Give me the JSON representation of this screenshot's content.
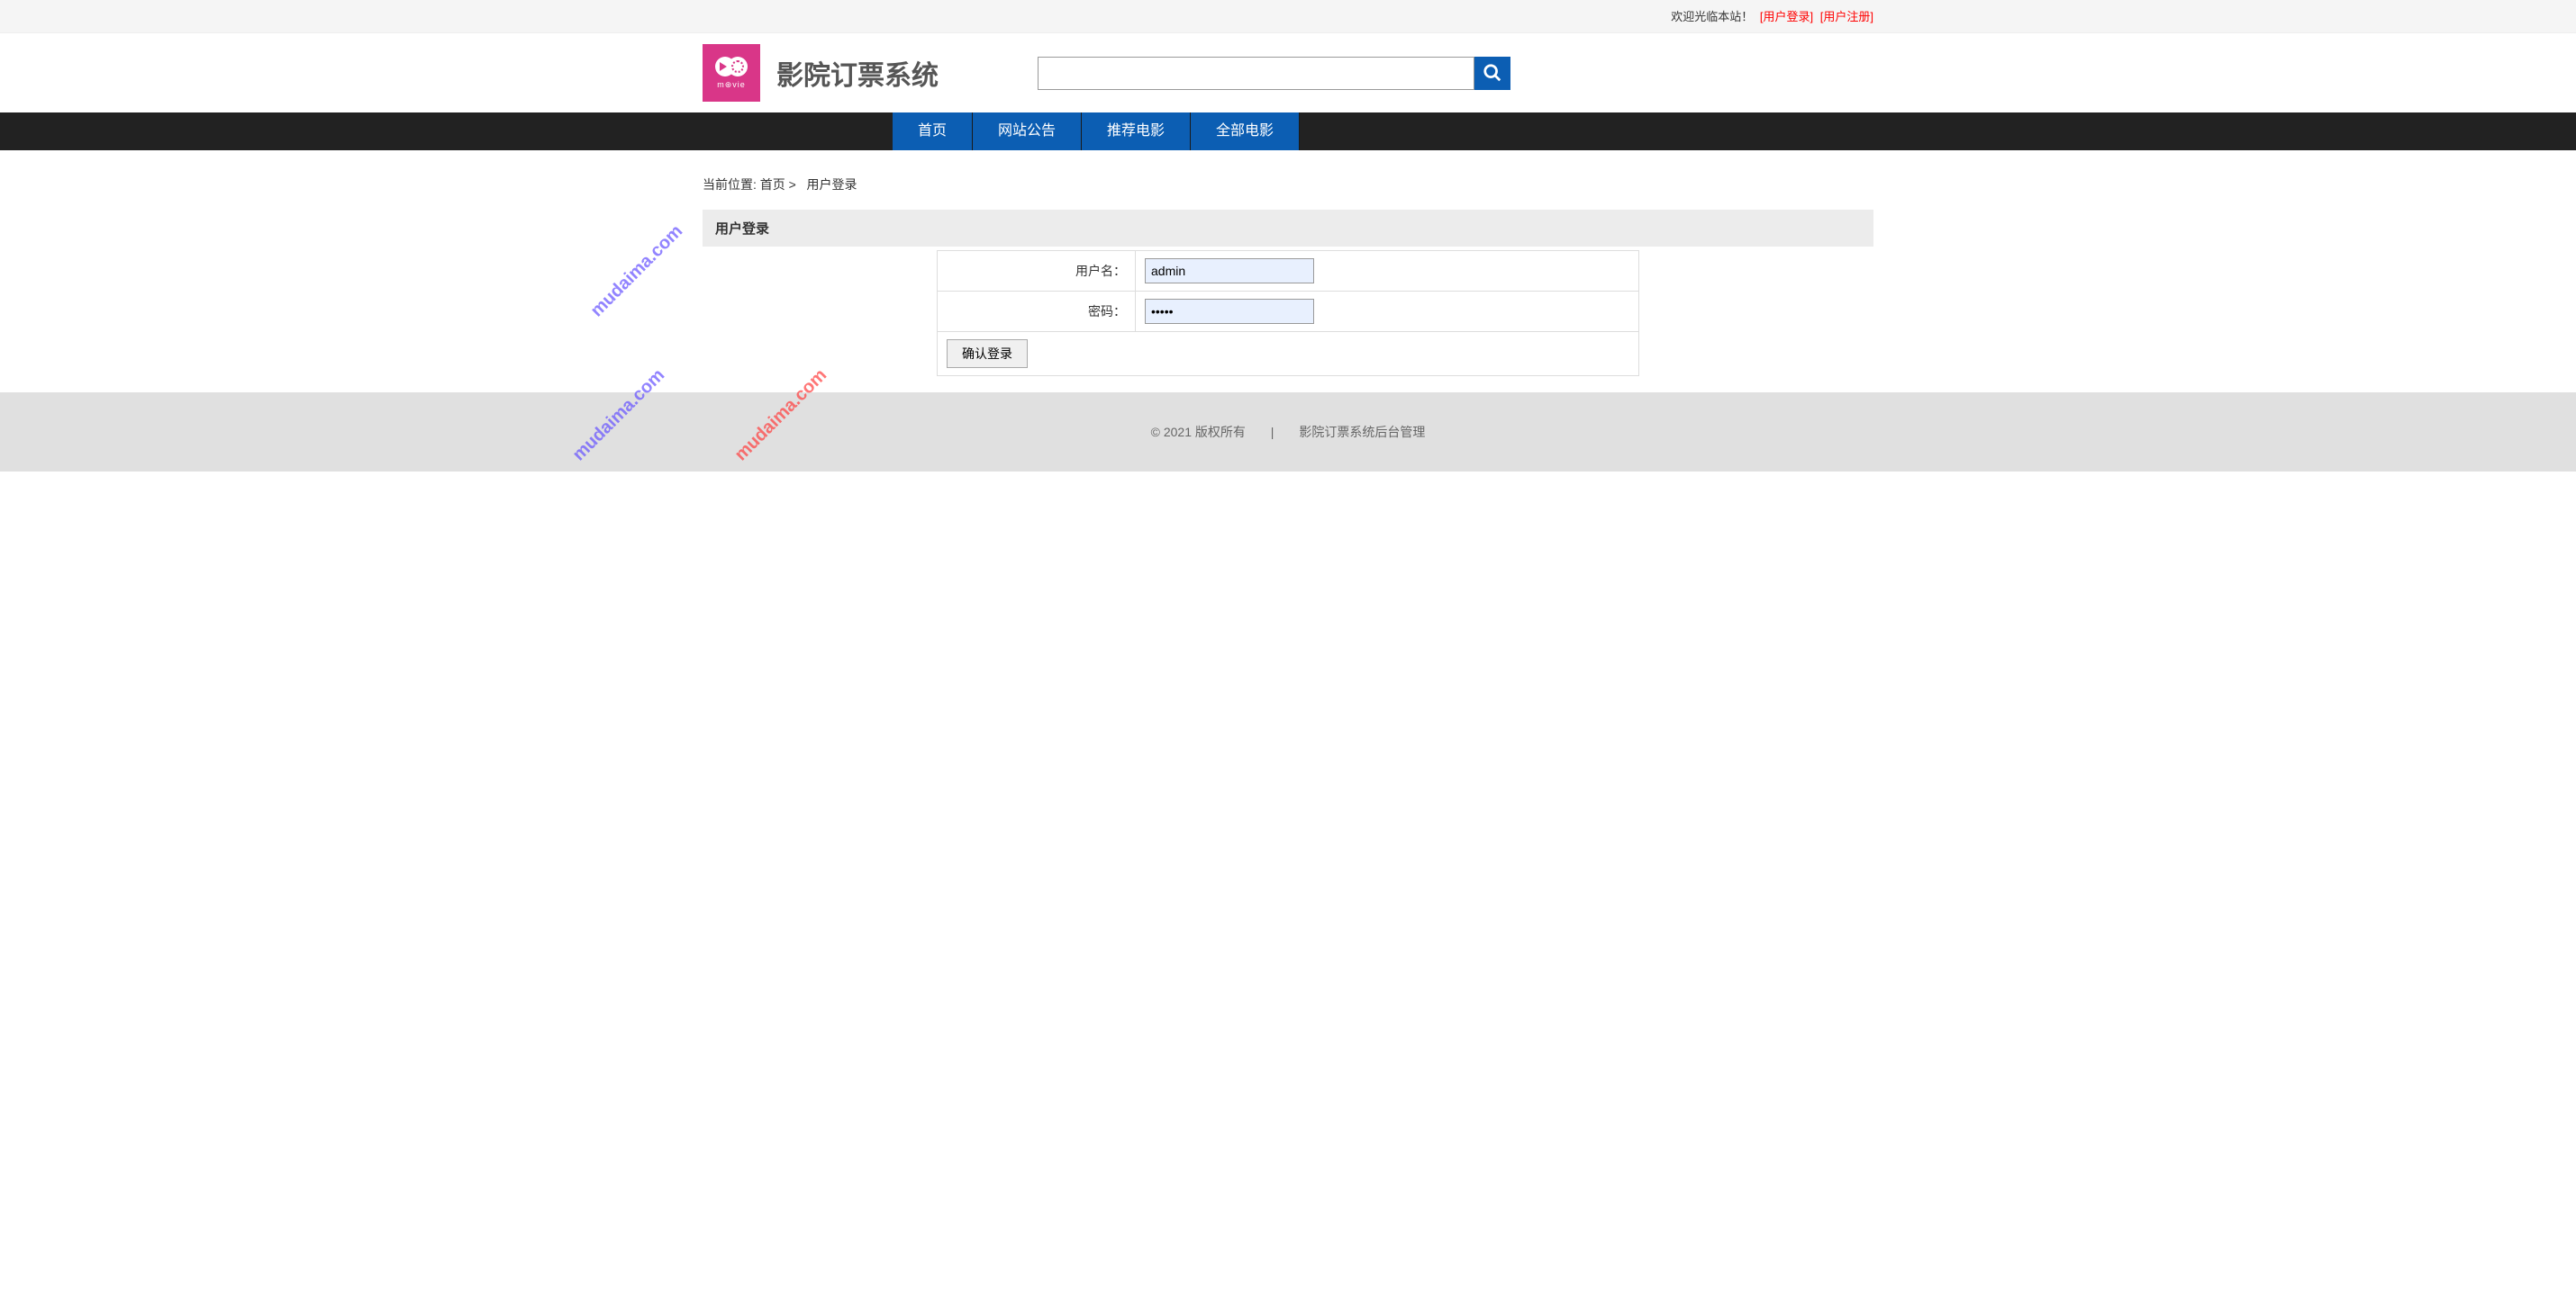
{
  "topbar": {
    "welcome": "欢迎光临本站！",
    "login_link": "[用户登录]",
    "register_link": "[用户注册]"
  },
  "header": {
    "logo_text": "m⊛vie",
    "site_title": "影院订票系统"
  },
  "nav": {
    "items": [
      {
        "label": "首页"
      },
      {
        "label": "网站公告"
      },
      {
        "label": "推荐电影"
      },
      {
        "label": "全部电影"
      }
    ]
  },
  "breadcrumb": {
    "prefix": "当前位置:",
    "home": "首页",
    "sep": ">",
    "current": "用户登录"
  },
  "panel": {
    "title": "用户登录",
    "username_label": "用户名：",
    "username_value": "admin",
    "password_label": "密码：",
    "password_value": "•••••",
    "submit_label": "确认登录"
  },
  "footer": {
    "copyright": "© 2021 版权所有",
    "divider": "|",
    "admin_link": "影院订票系统后台管理"
  },
  "watermarks": [
    {
      "text": "mudaima.com"
    },
    {
      "text": "mudaima.com"
    },
    {
      "text": "mudaima.com"
    }
  ]
}
